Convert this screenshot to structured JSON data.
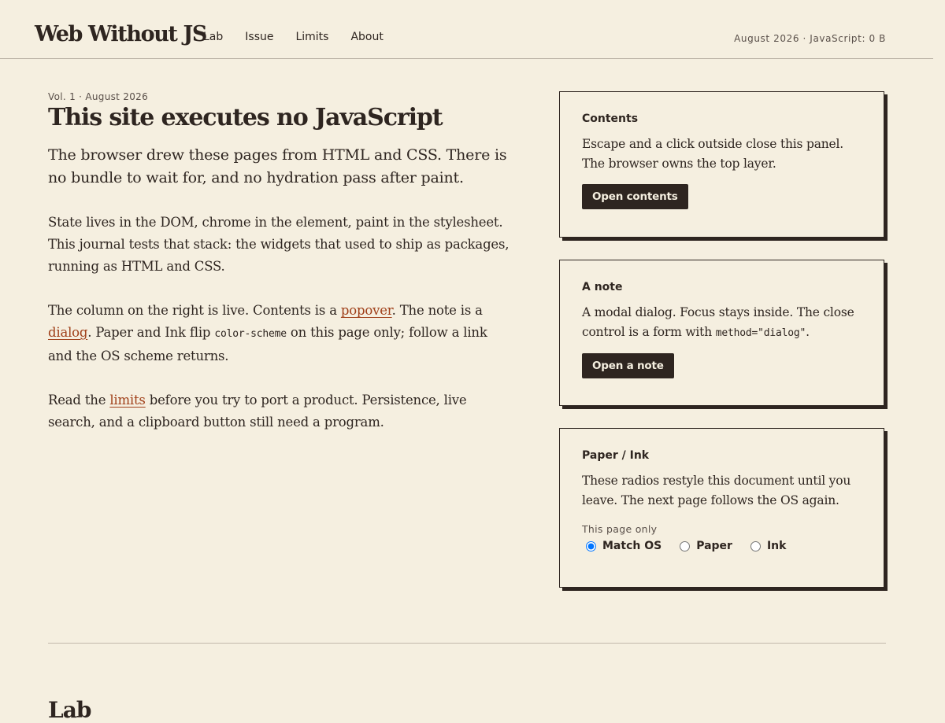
{
  "header": {
    "brand": "Web Without JS",
    "nav": [
      {
        "label": "Lab"
      },
      {
        "label": "Issue"
      },
      {
        "label": "Limits"
      },
      {
        "label": "About"
      }
    ],
    "meta": "August 2026 · JavaScript: 0 B"
  },
  "article": {
    "issue_line": "Vol. 1 · August 2026",
    "headline": "This site executes no JavaScript",
    "lede": "The browser drew these pages from HTML and CSS. There is no bundle to wait for, and no hydration pass after paint.",
    "para1": "State lives in the DOM, chrome in the element, paint in the stylesheet. This journal tests that stack: the widgets that used to ship as packages, running as HTML and CSS.",
    "para2": {
      "t1": "The column on the right is live. Contents is a ",
      "link1": "popover",
      "t2": ". The note is a ",
      "link2": "dialog",
      "t3": ". Paper and Ink flip ",
      "code": "color-scheme",
      "t4": " on this page only; follow a link and the OS scheme returns."
    },
    "para3": {
      "t1": "Read the ",
      "link": "limits",
      "t2": " before you try to port a product. Persistence, live search, and a clipboard button still need a program."
    }
  },
  "cards": {
    "contents": {
      "title": "Contents",
      "text": "Escape and a click outside close this panel. The browser owns the top layer.",
      "button": "Open contents"
    },
    "note": {
      "title": "A note",
      "t1": "A modal dialog. Focus stays inside. The close control is a form with ",
      "code": "method=\"dialog\"",
      "t2": ".",
      "button": "Open a note"
    },
    "theme": {
      "title": "Paper / Ink",
      "text": "These radios restyle this document until you leave. The next page follows the OS again.",
      "legend": "This page only",
      "options": [
        {
          "label": "Match OS",
          "checked": true
        },
        {
          "label": "Paper",
          "checked": false
        },
        {
          "label": "Ink",
          "checked": false
        }
      ]
    }
  },
  "next_section": {
    "heading": "Lab"
  },
  "colors": {
    "background": "#f5efe0",
    "ink": "#2e2520",
    "link": "#a0401a",
    "muted": "#5a504a"
  }
}
